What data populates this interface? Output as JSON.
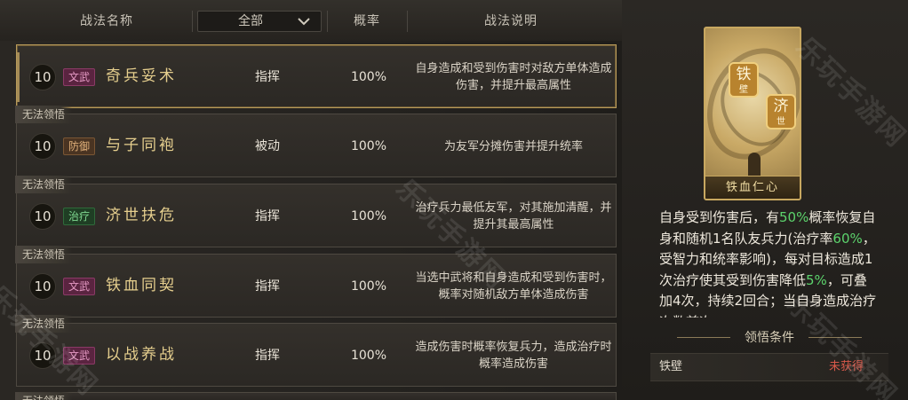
{
  "header": {
    "col_name": "战法名称",
    "filter_value": "全部",
    "col_rate": "概率",
    "col_desc": "战法说明"
  },
  "skills": [
    {
      "level": "10",
      "tag": "文武",
      "name": "奇兵妥术",
      "type": "指挥",
      "rate": "100%",
      "lock": "",
      "desc": "自身造成和受到伤害时对敌方单体造成伤害，并提升最高属性"
    },
    {
      "level": "10",
      "tag": "防御",
      "name": "与子同袍",
      "type": "被动",
      "rate": "100%",
      "lock": "无法领悟",
      "desc": "为友军分摊伤害并提升统率"
    },
    {
      "level": "10",
      "tag": "治疗",
      "name": "济世扶危",
      "type": "指挥",
      "rate": "100%",
      "lock": "无法领悟",
      "desc": "治疗兵力最低友军，对其施加清醒，并提升其最高属性"
    },
    {
      "level": "10",
      "tag": "文武",
      "name": "铁血同契",
      "type": "指挥",
      "rate": "100%",
      "lock": "无法领悟",
      "desc": "当选中武将和自身造成和受到伤害时，概率对随机敌方单体造成伤害"
    },
    {
      "level": "10",
      "tag": "文武",
      "name": "以战养战",
      "type": "指挥",
      "rate": "100%",
      "lock": "无法领悟",
      "desc": "造成伤害时概率恢复兵力，造成治疗时概率造成伤害"
    }
  ],
  "next_row_lock": "无法领悟",
  "detail": {
    "card_title": "铁血仁心",
    "seal_1": "铁",
    "seal_1_sub": "壁",
    "seal_2": "济",
    "seal_2_sub": "世",
    "desc_1": "自身受到伤害后，有",
    "desc_2": "50%",
    "desc_3": "概率恢复自身和随机1名队友兵力(治疗率",
    "desc_4": "60%",
    "desc_5": "，受智力和统率影响)，每对目标造成1次治疗使其受到伤害降低",
    "desc_6": "5%",
    "desc_7": "，可叠加4次，持续2回合；当自身造成治疗次数首次",
    "cond_title": "领悟条件",
    "cond_name": "铁壁",
    "cond_status": "未获得"
  },
  "watermark": "乐玩手游网",
  "colors": {
    "accent_gold": "#e6cf8e",
    "green": "#5cd36c",
    "red": "#d8594a"
  }
}
